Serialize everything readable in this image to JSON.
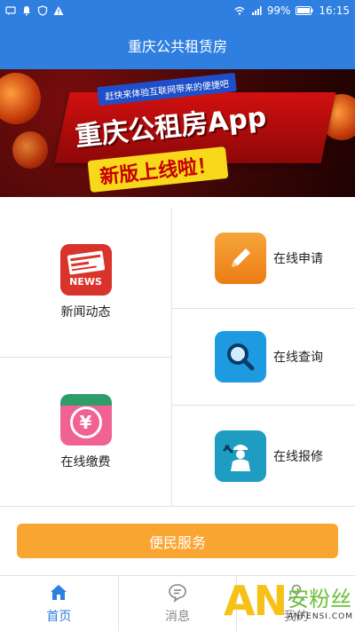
{
  "status_bar": {
    "battery": "99%",
    "time": "16:15"
  },
  "header": {
    "title": "重庆公共租赁房"
  },
  "banner": {
    "tag": "赶快来体验互联网带来的便捷吧",
    "title": "重庆公租房App",
    "subtitle": "新版上线啦！"
  },
  "tiles": {
    "news": {
      "label": "新闻动态",
      "icon_text": "NEWS",
      "icon_color": "#d9342b"
    },
    "apply": {
      "label": "在线申请",
      "icon_color": "#f29424"
    },
    "query": {
      "label": "在线查询",
      "icon_color": "#1e9be0"
    },
    "pay": {
      "label": "在线缴费",
      "icon_text": "¥",
      "icon_color": "#f06292"
    },
    "repair": {
      "label": "在线报修",
      "icon_color": "#1f9cc2"
    }
  },
  "service_button": {
    "label": "便民服务",
    "color": "#f9a532"
  },
  "tabbar": {
    "items": [
      {
        "label": "首页"
      },
      {
        "label": "消息"
      },
      {
        "label": "我的"
      }
    ]
  },
  "watermark": {
    "logo_text": "AN",
    "cn": "安粉丝",
    "en": "ANFENSI.COM"
  },
  "colors": {
    "primary": "#2f7fe0",
    "accent": "#f9a532"
  }
}
